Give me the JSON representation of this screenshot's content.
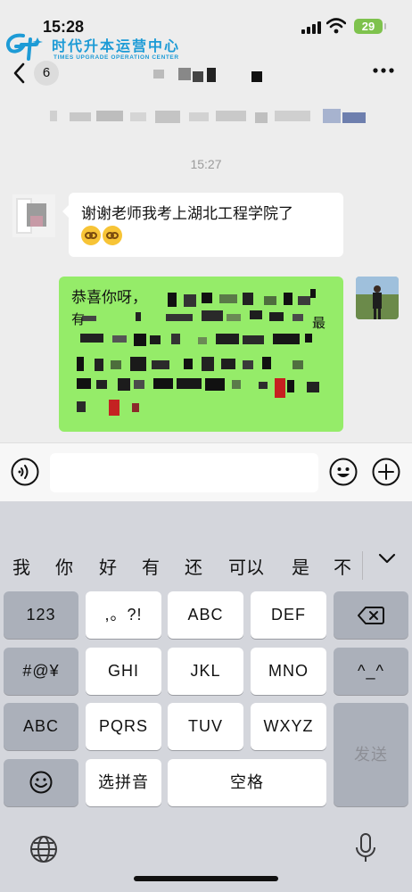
{
  "status_bar": {
    "time": "15:28",
    "battery": "29"
  },
  "watermark": {
    "name": "时代升本运营中心",
    "subtitle": "TIMES UPGRADE OPERATION CENTER"
  },
  "nav": {
    "unread_count": "6"
  },
  "chat": {
    "timestamp": "15:27",
    "incoming": {
      "text": "谢谢老师我考上湖北工程学院了"
    },
    "outgoing": {
      "text_visible_start": "恭喜你呀，",
      "text_fragment_2": "有",
      "text_fragment_tail": "最"
    }
  },
  "keyboard": {
    "candidates": [
      "我",
      "你",
      "好",
      "有",
      "还",
      "可以",
      "是",
      "不"
    ],
    "keys": {
      "numbers": "123",
      "punct": ",。?!",
      "abc": "ABC",
      "def": "DEF",
      "symbols": "#@¥",
      "ghi": "GHI",
      "jkl": "JKL",
      "mno": "MNO",
      "face": "^_^",
      "abc_mode": "ABC",
      "pqrs": "PQRS",
      "tuv": "TUV",
      "wxyz": "WXYZ",
      "send": "发送",
      "pinyin": "选拼音",
      "space": "空格"
    }
  },
  "colors": {
    "outgoing_bubble": "#95ec69",
    "incoming_bubble": "#ffffff",
    "chat_bg": "#ededed",
    "keyboard_bg": "#d4d6dc",
    "watermark": "#1d9bd6"
  }
}
